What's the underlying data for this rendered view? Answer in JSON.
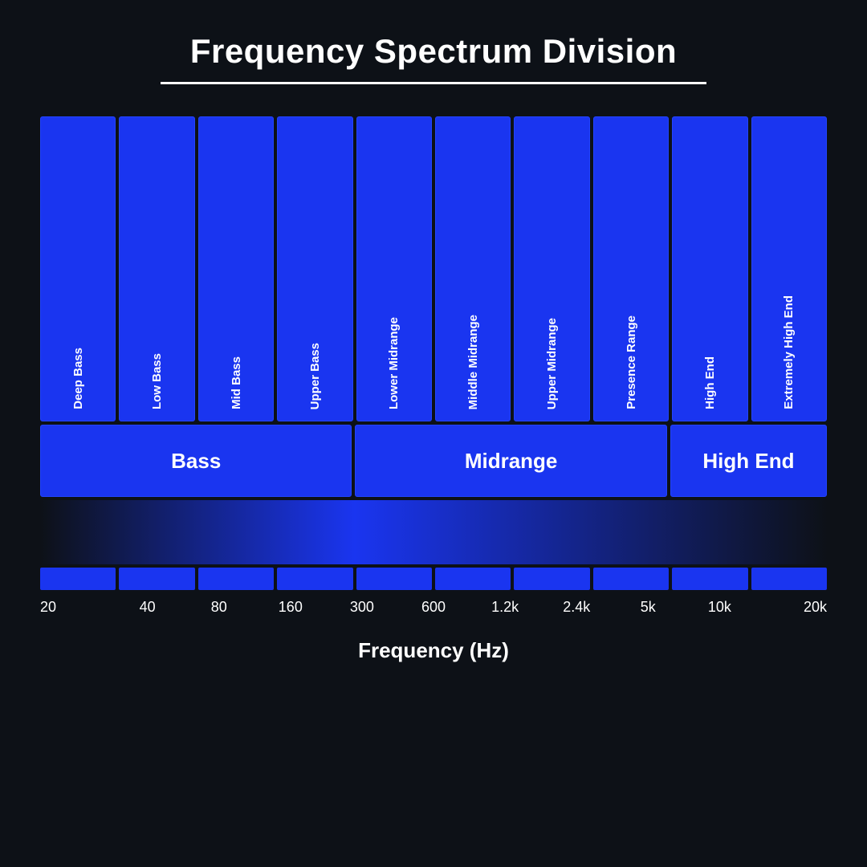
{
  "title": "Frequency Spectrum Division",
  "xAxisLabel": "Frequency (Hz)",
  "bands": [
    {
      "id": "deep-bass",
      "label": "Deep Bass"
    },
    {
      "id": "low-bass",
      "label": "Low Bass"
    },
    {
      "id": "mid-bass",
      "label": "Mid Bass"
    },
    {
      "id": "upper-bass",
      "label": "Upper Bass"
    },
    {
      "id": "lower-midrange",
      "label": "Lower Midrange"
    },
    {
      "id": "middle-midrange",
      "label": "Middle Midrange"
    },
    {
      "id": "upper-midrange",
      "label": "Upper Midrange"
    },
    {
      "id": "presence-range",
      "label": "Presence Range"
    },
    {
      "id": "high-end",
      "label": "High End"
    },
    {
      "id": "extremely-high-end",
      "label": "Extremely High End"
    }
  ],
  "groups": [
    {
      "id": "bass",
      "label": "Bass"
    },
    {
      "id": "midrange",
      "label": "Midrange"
    },
    {
      "id": "high-end",
      "label": "High End"
    }
  ],
  "freqLabels": [
    "20",
    "40",
    "80",
    "160",
    "300",
    "600",
    "1.2k",
    "2.4k",
    "5k",
    "10k",
    "20k"
  ]
}
